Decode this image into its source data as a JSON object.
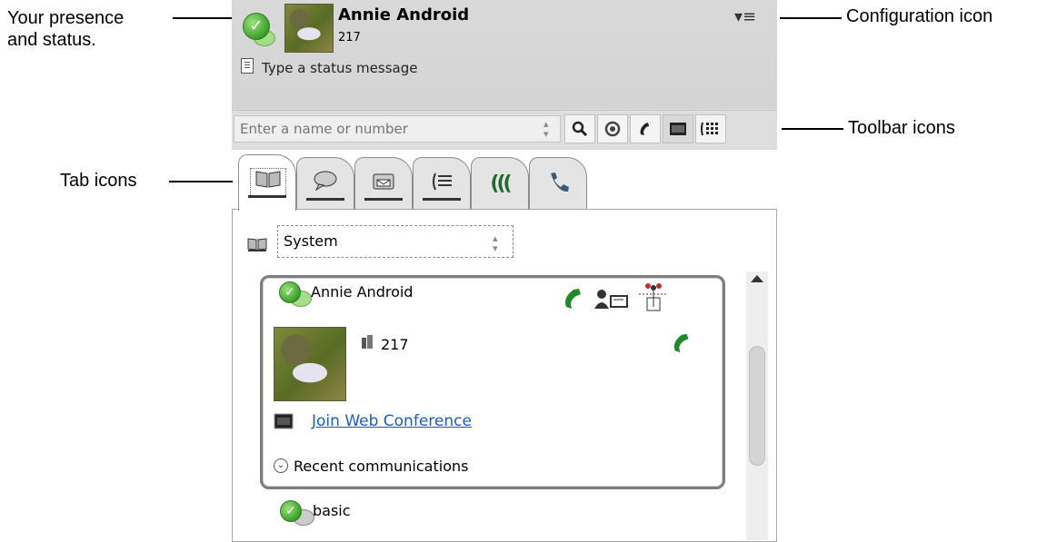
{
  "callouts": {
    "presence_line1": "Your presence",
    "presence_line2": "and status.",
    "configuration": "Configuration icon",
    "toolbar": "Toolbar icons",
    "tabs": "Tab icons"
  },
  "user": {
    "name": "Annie Android",
    "extension": "217",
    "status_placeholder": "Type a status message",
    "presence_icon": "available-presence-icon",
    "avatar": "user-photo"
  },
  "config_menu": {
    "glyph": "▾≡",
    "icon": "configuration-menu-icon"
  },
  "toolbar": {
    "search_placeholder": "Enter a name or number",
    "buttons": [
      {
        "icon": "search-icon",
        "glyph": "🔍"
      },
      {
        "icon": "voicemail-icon",
        "glyph": "◉"
      },
      {
        "icon": "phone-icon",
        "glyph": "✆"
      },
      {
        "icon": "web-conference-icon",
        "glyph": "▬"
      },
      {
        "icon": "dialpad-icon",
        "glyph": "⁙"
      }
    ]
  },
  "tabs": [
    {
      "icon": "directory-icon",
      "glyph": "📖"
    },
    {
      "icon": "chat-icon",
      "glyph": "💬"
    },
    {
      "icon": "voicemail-tab-icon",
      "glyph": "☎"
    },
    {
      "icon": "call-history-icon",
      "glyph": "☰"
    },
    {
      "icon": "conference-icon",
      "glyph": "((("
    },
    {
      "icon": "calls-icon",
      "glyph": "✆"
    }
  ],
  "directory": {
    "selected": "System",
    "contact": {
      "name": "Annie Android",
      "extension": "217",
      "web_conference_link": "Join Web Conference",
      "recent_label": "Recent communications"
    },
    "next_contact": "basic"
  },
  "colors": {
    "header_bg": "#d9d9d9",
    "presence_green": "#3aa02a",
    "phone_green": "#1f8a2a",
    "link_blue": "#1a5fb4"
  }
}
